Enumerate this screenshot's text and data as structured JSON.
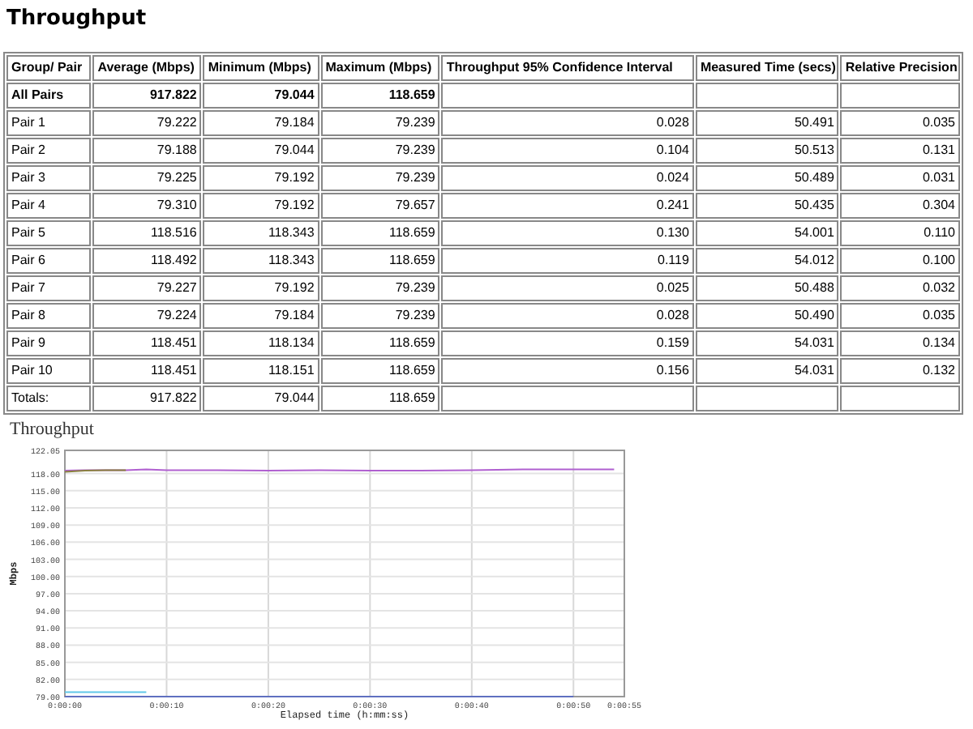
{
  "title": "Throughput",
  "table": {
    "columns": [
      "Group/ Pair",
      "Average (Mbps)",
      "Minimum (Mbps)",
      "Maximum (Mbps)",
      "Throughput 95% Confidence Interval",
      "Measured Time (secs)",
      "Relative Precision"
    ],
    "rows": [
      {
        "kind": "summary",
        "cells": [
          "All Pairs",
          "917.822",
          "79.044",
          "118.659",
          "",
          "",
          ""
        ]
      },
      {
        "kind": "pair",
        "cells": [
          "Pair 1",
          "79.222",
          "79.184",
          "79.239",
          "0.028",
          "50.491",
          "0.035"
        ]
      },
      {
        "kind": "pair",
        "cells": [
          "Pair 2",
          "79.188",
          "79.044",
          "79.239",
          "0.104",
          "50.513",
          "0.131"
        ]
      },
      {
        "kind": "pair",
        "cells": [
          "Pair 3",
          "79.225",
          "79.192",
          "79.239",
          "0.024",
          "50.489",
          "0.031"
        ]
      },
      {
        "kind": "pair",
        "cells": [
          "Pair 4",
          "79.310",
          "79.192",
          "79.657",
          "0.241",
          "50.435",
          "0.304"
        ]
      },
      {
        "kind": "pair",
        "cells": [
          "Pair 5",
          "118.516",
          "118.343",
          "118.659",
          "0.130",
          "54.001",
          "0.110"
        ]
      },
      {
        "kind": "pair",
        "cells": [
          "Pair 6",
          "118.492",
          "118.343",
          "118.659",
          "0.119",
          "54.012",
          "0.100"
        ]
      },
      {
        "kind": "pair",
        "cells": [
          "Pair 7",
          "79.227",
          "79.192",
          "79.239",
          "0.025",
          "50.488",
          "0.032"
        ]
      },
      {
        "kind": "pair",
        "cells": [
          "Pair 8",
          "79.224",
          "79.184",
          "79.239",
          "0.028",
          "50.490",
          "0.035"
        ]
      },
      {
        "kind": "pair",
        "cells": [
          "Pair 9",
          "118.451",
          "118.134",
          "118.659",
          "0.159",
          "54.031",
          "0.134"
        ]
      },
      {
        "kind": "pair",
        "cells": [
          "Pair 10",
          "118.451",
          "118.151",
          "118.659",
          "0.156",
          "54.031",
          "0.132"
        ]
      },
      {
        "kind": "total",
        "cells": [
          "Totals:",
          "917.822",
          "79.044",
          "118.659",
          "",
          "",
          ""
        ]
      }
    ]
  },
  "chart": {
    "chart_data": {
      "type": "line",
      "title": "Throughput",
      "xlabel": "Elapsed time (h:mm:ss)",
      "ylabel": "Mbps",
      "x": [
        0,
        2,
        4,
        6,
        8,
        10,
        15,
        20,
        25,
        30,
        35,
        40,
        45,
        50,
        54
      ],
      "series": [
        {
          "color": "#b060d0",
          "values": [
            118.5,
            118.6,
            118.6,
            118.6,
            118.7,
            118.6,
            118.6,
            118.5,
            118.6,
            118.5,
            118.5,
            118.6,
            118.7,
            118.7,
            118.7
          ]
        },
        {
          "color": "#8a8040",
          "values": [
            118.3,
            118.5,
            118.6,
            118.6,
            null,
            null,
            null,
            null,
            null,
            null,
            null,
            null,
            null,
            null,
            null
          ]
        },
        {
          "color": "#60c8e8",
          "values": [
            79.8,
            79.8,
            79.8,
            79.8,
            79.8,
            null,
            null,
            null,
            null,
            null,
            null,
            null,
            null,
            null,
            null
          ]
        },
        {
          "color": "#6070c0",
          "values": [
            79.0,
            79.0,
            79.0,
            79.0,
            79.0,
            79.0,
            79.0,
            79.0,
            79.0,
            79.0,
            79.0,
            79.0,
            79.0,
            79.0,
            null
          ]
        }
      ],
      "grid": true,
      "xlim": [
        0,
        55
      ],
      "ylim": [
        79,
        122.05
      ],
      "xticks": [
        {
          "value": 0,
          "label": "0:00:00"
        },
        {
          "value": 10,
          "label": "0:00:10"
        },
        {
          "value": 20,
          "label": "0:00:20"
        },
        {
          "value": 30,
          "label": "0:00:30"
        },
        {
          "value": 40,
          "label": "0:00:40"
        },
        {
          "value": 50,
          "label": "0:00:50"
        },
        {
          "value": 55,
          "label": "0:00:55"
        }
      ],
      "yticks": [
        {
          "value": 79,
          "label": "79.00"
        },
        {
          "value": 82,
          "label": "82.00"
        },
        {
          "value": 85,
          "label": "85.00"
        },
        {
          "value": 88,
          "label": "88.00"
        },
        {
          "value": 91,
          "label": "91.00"
        },
        {
          "value": 94,
          "label": "94.00"
        },
        {
          "value": 97,
          "label": "97.00"
        },
        {
          "value": 100,
          "label": "100.00"
        },
        {
          "value": 103,
          "label": "103.00"
        },
        {
          "value": 106,
          "label": "106.00"
        },
        {
          "value": 109,
          "label": "109.00"
        },
        {
          "value": 112,
          "label": "112.00"
        },
        {
          "value": 115,
          "label": "115.00"
        },
        {
          "value": 118,
          "label": "118.00"
        },
        {
          "value": 122.05,
          "label": "122.05"
        }
      ]
    }
  }
}
